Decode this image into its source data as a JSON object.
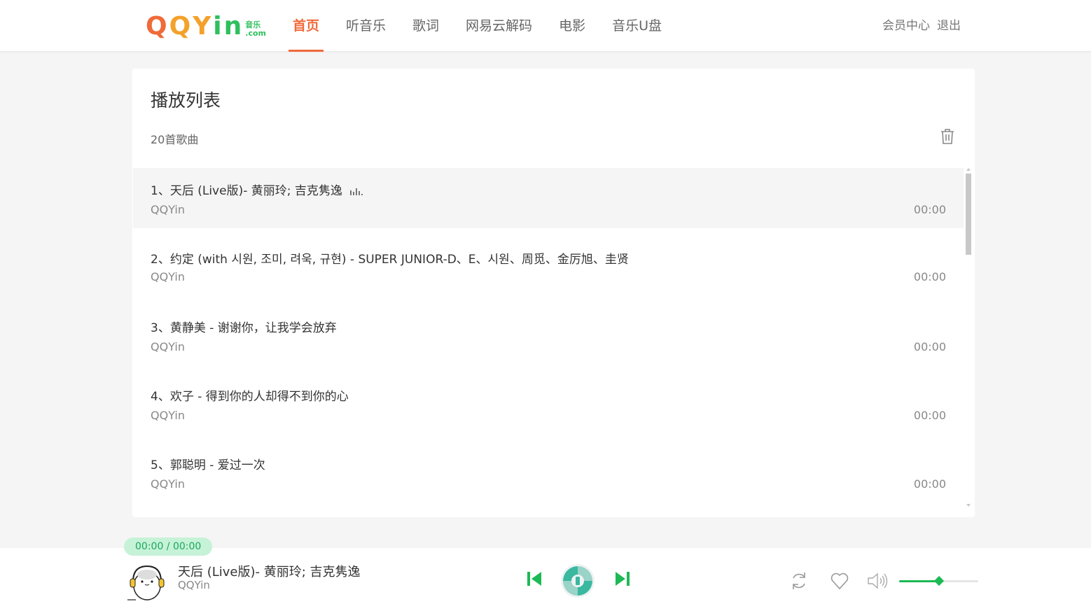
{
  "header": {
    "logo": {
      "main_q1": "Q",
      "main_q2": "Q",
      "main_y": "Y",
      "main_in": "in",
      "sub_top": "音乐",
      "sub_bottom": ".com"
    },
    "nav": [
      {
        "label": "首页",
        "active": true
      },
      {
        "label": "听音乐"
      },
      {
        "label": "歌词"
      },
      {
        "label": "网易云解码"
      },
      {
        "label": "电影"
      },
      {
        "label": "音乐U盘"
      }
    ],
    "user_center": "会员中心",
    "logout": "退出"
  },
  "playlist": {
    "title": "播放列表",
    "count": "20首歌曲",
    "songs": [
      {
        "title": "1、天后 (Live版)- 黄丽玲; 吉克隽逸",
        "artist": "QQYin",
        "duration": "00:00",
        "playing": true
      },
      {
        "title": "2、约定 (with 시원, 조미, 려욱, 규현) - SUPER JUNIOR-D、E、시원、周觅、金厉旭、圭贤",
        "artist": "QQYin",
        "duration": "00:00"
      },
      {
        "title": "3、黄静美 - 谢谢你，让我学会放弃",
        "artist": "QQYin",
        "duration": "00:00"
      },
      {
        "title": "4、欢子 - 得到你的人却得不到你的心",
        "artist": "QQYin",
        "duration": "00:00"
      },
      {
        "title": "5、郭聪明 - 爱过一次",
        "artist": "QQYin",
        "duration": "00:00"
      }
    ]
  },
  "player": {
    "time": "00:00  / 00:00",
    "title": "天后 (Live版)- 黄丽玲; 吉克隽逸",
    "artist": "QQYin",
    "volume_percent": 50,
    "colors": {
      "accent": "#1db954",
      "brand": "#f06a3a",
      "disc": "#3bb8a0"
    }
  }
}
